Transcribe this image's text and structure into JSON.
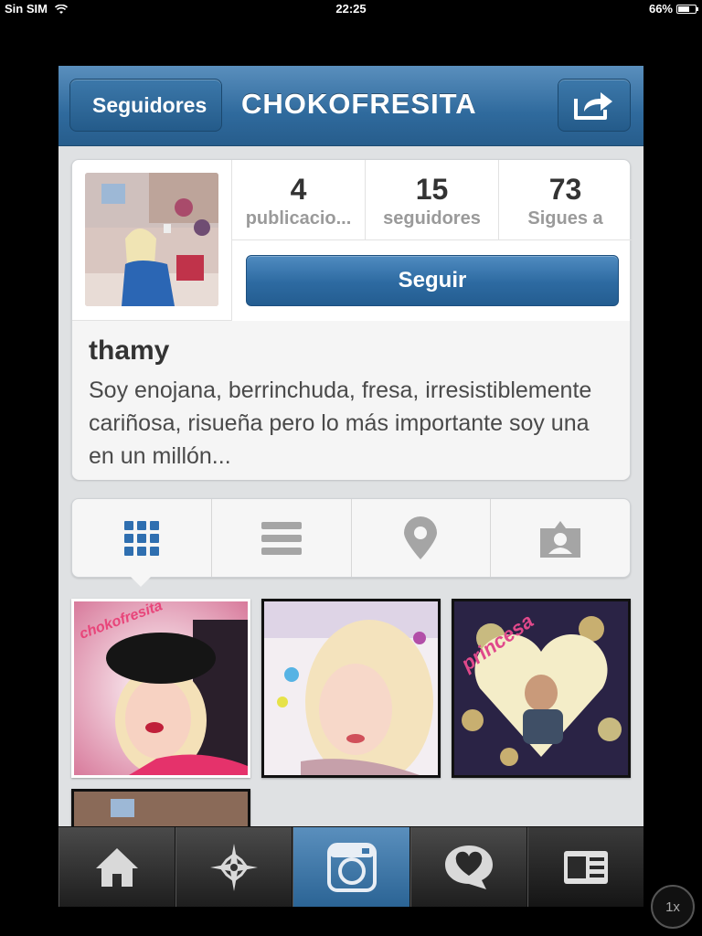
{
  "status_bar": {
    "carrier": "Sin SIM",
    "time": "22:25",
    "battery": "66%",
    "battery_level": 0.66
  },
  "navbar": {
    "back_label": "Seguidores",
    "title": "CHOKOFRESITA",
    "share_icon": "share-icon"
  },
  "profile": {
    "stats": [
      {
        "number": "4",
        "label": "publicacio..."
      },
      {
        "number": "15",
        "label": "seguidores"
      },
      {
        "number": "73",
        "label": "Sigues a"
      }
    ],
    "follow_label": "Seguir",
    "name": "thamy",
    "bio": "Soy enojana, berrinchuda, fresa, irresistiblemente cariñosa, risueña pero lo más importante soy una en un millón..."
  },
  "view_tabs": [
    "grid-icon",
    "list-icon",
    "location-pin-icon",
    "tagged-user-icon"
  ],
  "photos": [
    {
      "overlay_text": "chokofresita",
      "accent": "#e8457a"
    },
    {
      "overlay_text": "",
      "accent": "#b24fa8"
    },
    {
      "overlay_text": "princesa",
      "accent": "#e0498b"
    },
    {
      "overlay_text": "",
      "accent": "#8a6a58"
    }
  ],
  "tab_bar": [
    "home-icon",
    "explore-star-icon",
    "camera-icon",
    "news-heart-bubble-icon",
    "profile-card-icon"
  ],
  "zoom": "1x",
  "colors": {
    "nav_blue": "#2f6a9d",
    "follow_blue": "#2d6aa1",
    "active_tab": "#3d77ab"
  }
}
